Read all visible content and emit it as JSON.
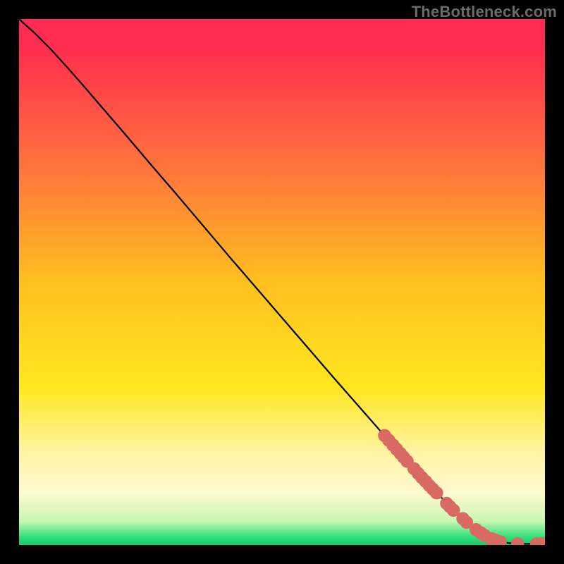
{
  "watermark": "TheBottleneck.com",
  "chart_data": {
    "type": "line",
    "title": "",
    "xlabel": "",
    "ylabel": "",
    "xlim": [
      0,
      100
    ],
    "ylim": [
      0,
      100
    ],
    "gradient_stops": [
      {
        "offset": 0.0,
        "color": "#ff2a55"
      },
      {
        "offset": 0.06,
        "color": "#ff2f4f"
      },
      {
        "offset": 0.3,
        "color": "#ff7a3a"
      },
      {
        "offset": 0.5,
        "color": "#ffbf20"
      },
      {
        "offset": 0.7,
        "color": "#ffe720"
      },
      {
        "offset": 0.82,
        "color": "#fff3a0"
      },
      {
        "offset": 0.9,
        "color": "#fffad0"
      },
      {
        "offset": 0.955,
        "color": "#c8f7b0"
      },
      {
        "offset": 0.985,
        "color": "#2fe07a"
      },
      {
        "offset": 1.0,
        "color": "#18c96a"
      }
    ],
    "curve": [
      {
        "x": 0,
        "y": 100.0
      },
      {
        "x": 3,
        "y": 97.3
      },
      {
        "x": 6,
        "y": 94.3
      },
      {
        "x": 9,
        "y": 91.0
      },
      {
        "x": 12,
        "y": 87.6
      },
      {
        "x": 15,
        "y": 84.1
      },
      {
        "x": 20,
        "y": 78.3
      },
      {
        "x": 25,
        "y": 72.4
      },
      {
        "x": 30,
        "y": 66.6
      },
      {
        "x": 35,
        "y": 60.7
      },
      {
        "x": 40,
        "y": 54.8
      },
      {
        "x": 45,
        "y": 49.0
      },
      {
        "x": 50,
        "y": 43.2
      },
      {
        "x": 55,
        "y": 37.4
      },
      {
        "x": 60,
        "y": 31.6
      },
      {
        "x": 65,
        "y": 25.9
      },
      {
        "x": 70,
        "y": 20.2
      },
      {
        "x": 75,
        "y": 14.6
      },
      {
        "x": 80,
        "y": 9.3
      },
      {
        "x": 85,
        "y": 4.5
      },
      {
        "x": 90,
        "y": 1.2
      },
      {
        "x": 93,
        "y": 0.35
      },
      {
        "x": 96,
        "y": 0.2
      },
      {
        "x": 100,
        "y": 0.2
      }
    ],
    "scatter": [
      {
        "x": 69.5,
        "y": 20.8
      },
      {
        "x": 70.3,
        "y": 19.9
      },
      {
        "x": 71.1,
        "y": 19.0
      },
      {
        "x": 71.8,
        "y": 18.2
      },
      {
        "x": 72.5,
        "y": 17.4
      },
      {
        "x": 73.1,
        "y": 16.7
      },
      {
        "x": 73.8,
        "y": 15.9
      },
      {
        "x": 75.1,
        "y": 14.5
      },
      {
        "x": 75.9,
        "y": 13.6
      },
      {
        "x": 76.6,
        "y": 12.8
      },
      {
        "x": 77.3,
        "y": 12.1
      },
      {
        "x": 78.0,
        "y": 11.3
      },
      {
        "x": 78.7,
        "y": 10.6
      },
      {
        "x": 79.4,
        "y": 9.9
      },
      {
        "x": 81.3,
        "y": 7.9
      },
      {
        "x": 81.9,
        "y": 7.3
      },
      {
        "x": 82.6,
        "y": 6.6
      },
      {
        "x": 84.4,
        "y": 5.0
      },
      {
        "x": 85.1,
        "y": 4.3
      },
      {
        "x": 86.9,
        "y": 2.9
      },
      {
        "x": 87.8,
        "y": 2.3
      },
      {
        "x": 88.5,
        "y": 1.8
      },
      {
        "x": 89.8,
        "y": 1.2
      },
      {
        "x": 90.6,
        "y": 0.9
      },
      {
        "x": 91.5,
        "y": 0.6
      },
      {
        "x": 94.8,
        "y": 0.22
      },
      {
        "x": 98.4,
        "y": 0.2
      },
      {
        "x": 99.4,
        "y": 0.2
      }
    ],
    "scatter_color": "#d86a63",
    "scatter_radius": 1.25,
    "curve_color": "#000000",
    "curve_width": 0.3
  }
}
